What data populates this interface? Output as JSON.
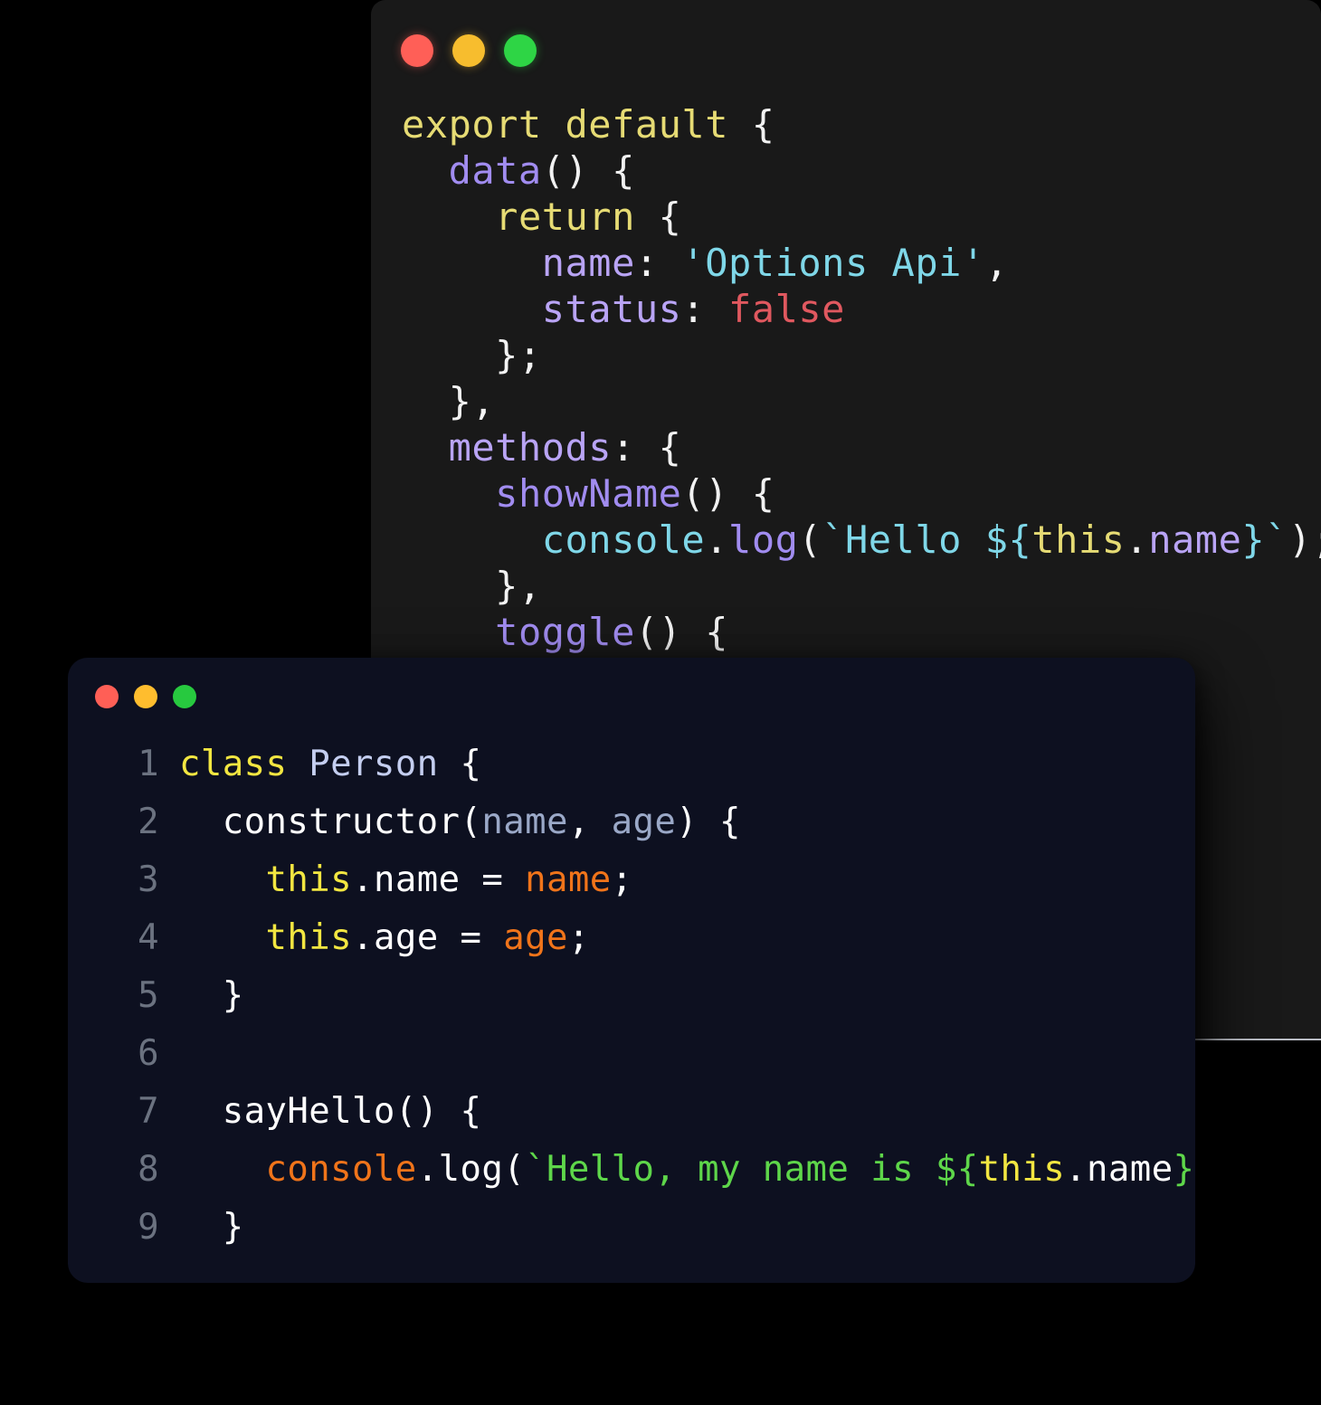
{
  "page": {
    "background_color": "#000000",
    "description": "Two overlapping macOS-style code editor windows on a black background"
  },
  "back_window": {
    "name": "options-api-code-window",
    "background_color": "#191919",
    "traffic_lights": [
      {
        "name": "close-button",
        "color": "#ff5f57"
      },
      {
        "name": "minimize-button",
        "color": "#f7bd2e"
      },
      {
        "name": "maximize-button",
        "color": "#2ed545"
      }
    ],
    "lines": [
      [
        {
          "t": "export default ",
          "c": "b-kw"
        },
        {
          "t": "{",
          "c": "b-punc"
        }
      ],
      [
        {
          "t": "  ",
          "c": "b-punc"
        },
        {
          "t": "data",
          "c": "b-fn"
        },
        {
          "t": "() {",
          "c": "b-punc"
        }
      ],
      [
        {
          "t": "    ",
          "c": "b-punc"
        },
        {
          "t": "return",
          "c": "b-kw"
        },
        {
          "t": " {",
          "c": "b-punc"
        }
      ],
      [
        {
          "t": "      ",
          "c": "b-punc"
        },
        {
          "t": "name",
          "c": "b-key"
        },
        {
          "t": ": ",
          "c": "b-punc"
        },
        {
          "t": "'Options Api'",
          "c": "b-str"
        },
        {
          "t": ",",
          "c": "b-punc"
        }
      ],
      [
        {
          "t": "      ",
          "c": "b-punc"
        },
        {
          "t": "status",
          "c": "b-key"
        },
        {
          "t": ": ",
          "c": "b-punc"
        },
        {
          "t": "false",
          "c": "b-bool"
        }
      ],
      [
        {
          "t": "    };",
          "c": "b-punc"
        }
      ],
      [
        {
          "t": "  },",
          "c": "b-punc"
        }
      ],
      [
        {
          "t": "  ",
          "c": "b-punc"
        },
        {
          "t": "methods",
          "c": "b-key"
        },
        {
          "t": ": {",
          "c": "b-punc"
        }
      ],
      [
        {
          "t": "    ",
          "c": "b-punc"
        },
        {
          "t": "showName",
          "c": "b-fn"
        },
        {
          "t": "() {",
          "c": "b-punc"
        }
      ],
      [
        {
          "t": "      ",
          "c": "b-punc"
        },
        {
          "t": "console",
          "c": "b-mod"
        },
        {
          "t": ".",
          "c": "b-punc"
        },
        {
          "t": "log",
          "c": "b-meth"
        },
        {
          "t": "(",
          "c": "b-punc"
        },
        {
          "t": "`Hello ",
          "c": "b-str"
        },
        {
          "t": "${",
          "c": "b-str"
        },
        {
          "t": "this",
          "c": "b-this"
        },
        {
          "t": ".",
          "c": "b-punc"
        },
        {
          "t": "name",
          "c": "b-prop"
        },
        {
          "t": "}`",
          "c": "b-str"
        },
        {
          "t": ");",
          "c": "b-punc"
        }
      ],
      [
        {
          "t": "    },",
          "c": "b-punc"
        }
      ],
      [
        {
          "t": "    ",
          "c": "b-punc"
        },
        {
          "t": "toggle",
          "c": "b-fn"
        },
        {
          "t": "() {",
          "c": "b-punc"
        }
      ]
    ]
  },
  "front_window": {
    "name": "person-class-code-window",
    "background_color": "#0d1020",
    "traffic_lights": [
      {
        "name": "close-button",
        "color": "#ff5f56"
      },
      {
        "name": "minimize-button",
        "color": "#ffbd2e"
      },
      {
        "name": "maximize-button",
        "color": "#27c93f"
      }
    ],
    "line_number_color": "#6b7280",
    "lines": [
      {
        "num": "1",
        "tokens": [
          {
            "t": "class ",
            "c": "f-kw"
          },
          {
            "t": "Person",
            "c": "f-cls"
          },
          {
            "t": " {",
            "c": "f-plain"
          }
        ]
      },
      {
        "num": "2",
        "tokens": [
          {
            "t": "  constructor(",
            "c": "f-plain"
          },
          {
            "t": "name",
            "c": "f-param"
          },
          {
            "t": ", ",
            "c": "f-plain"
          },
          {
            "t": "age",
            "c": "f-param"
          },
          {
            "t": ") {",
            "c": "f-plain"
          }
        ]
      },
      {
        "num": "3",
        "tokens": [
          {
            "t": "    ",
            "c": "f-plain"
          },
          {
            "t": "this",
            "c": "f-this"
          },
          {
            "t": ".name = ",
            "c": "f-plain"
          },
          {
            "t": "name",
            "c": "f-val"
          },
          {
            "t": ";",
            "c": "f-plain"
          }
        ]
      },
      {
        "num": "4",
        "tokens": [
          {
            "t": "    ",
            "c": "f-plain"
          },
          {
            "t": "this",
            "c": "f-this"
          },
          {
            "t": ".age = ",
            "c": "f-plain"
          },
          {
            "t": "age",
            "c": "f-val"
          },
          {
            "t": ";",
            "c": "f-plain"
          }
        ]
      },
      {
        "num": "5",
        "tokens": [
          {
            "t": "  }",
            "c": "f-plain"
          }
        ]
      },
      {
        "num": "6",
        "tokens": [
          {
            "t": "",
            "c": "f-plain"
          }
        ]
      },
      {
        "num": "7",
        "tokens": [
          {
            "t": "  sayHello() {",
            "c": "f-plain"
          }
        ]
      },
      {
        "num": "8",
        "tokens": [
          {
            "t": "    ",
            "c": "f-plain"
          },
          {
            "t": "console",
            "c": "f-val"
          },
          {
            "t": ".log(",
            "c": "f-plain"
          },
          {
            "t": "`Hello, my name is ",
            "c": "f-str"
          },
          {
            "t": "${",
            "c": "f-str"
          },
          {
            "t": "this",
            "c": "f-this"
          },
          {
            "t": ".name",
            "c": "f-plain"
          },
          {
            "t": "}`",
            "c": "f-str"
          },
          {
            "t": ");",
            "c": "f-plain"
          }
        ]
      },
      {
        "num": "9",
        "tokens": [
          {
            "t": "  }",
            "c": "f-plain"
          }
        ]
      }
    ]
  }
}
